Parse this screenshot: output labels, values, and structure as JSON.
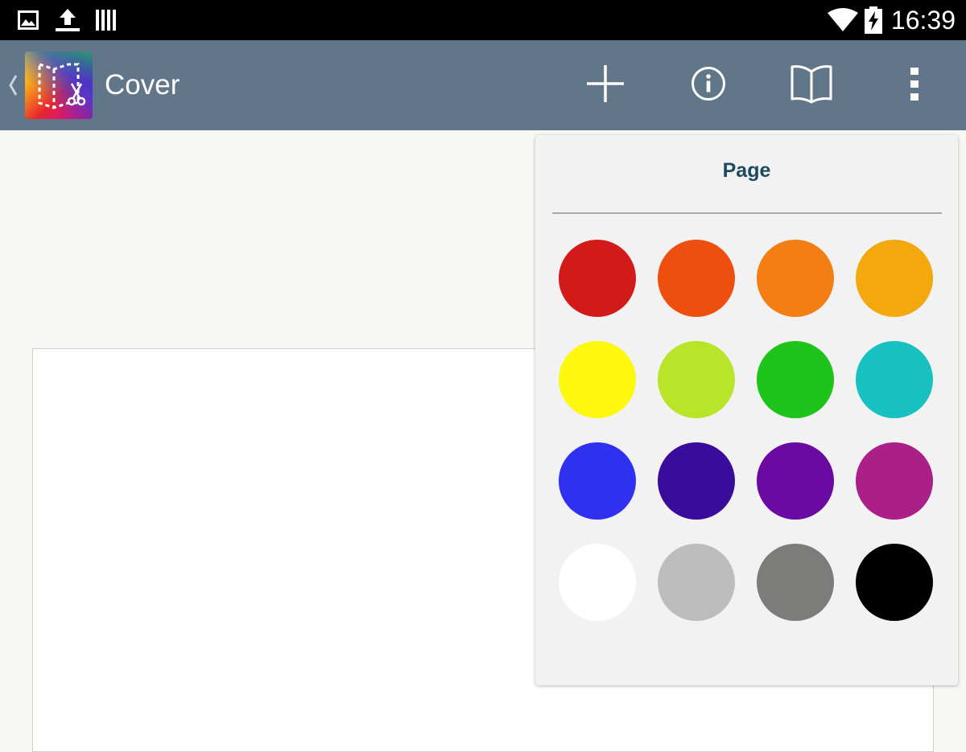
{
  "status_bar": {
    "time": "16:39",
    "icons": [
      "image-notification-icon",
      "upload-icon",
      "barcode-icon",
      "wifi-icon",
      "battery-charging-icon"
    ]
  },
  "action_bar": {
    "title": "Cover",
    "buttons": [
      "add-icon",
      "info-icon",
      "book-icon",
      "overflow-menu-icon"
    ]
  },
  "popup": {
    "title": "Page",
    "swatches": [
      {
        "name": "red",
        "color": "#d21a1a"
      },
      {
        "name": "red-orange",
        "color": "#ee4f0e"
      },
      {
        "name": "orange",
        "color": "#f27e14"
      },
      {
        "name": "amber",
        "color": "#f3a90e"
      },
      {
        "name": "yellow",
        "color": "#fdf80e"
      },
      {
        "name": "lime",
        "color": "#b8e52a"
      },
      {
        "name": "green",
        "color": "#1ec41a"
      },
      {
        "name": "teal",
        "color": "#17c1c1"
      },
      {
        "name": "blue",
        "color": "#3030f0"
      },
      {
        "name": "indigo",
        "color": "#3a0c9c"
      },
      {
        "name": "purple",
        "color": "#6a0aa3"
      },
      {
        "name": "magenta",
        "color": "#ab1f89"
      },
      {
        "name": "white",
        "color": "#ffffff"
      },
      {
        "name": "light-gray",
        "color": "#bdbdbd"
      },
      {
        "name": "gray",
        "color": "#7c7d7b"
      },
      {
        "name": "black",
        "color": "#000000"
      }
    ]
  },
  "colors": {
    "action_bar": "#62768a",
    "status_bar": "#000000",
    "popup_background": "#f2f2f2",
    "popup_title": "#1d4a5e"
  }
}
